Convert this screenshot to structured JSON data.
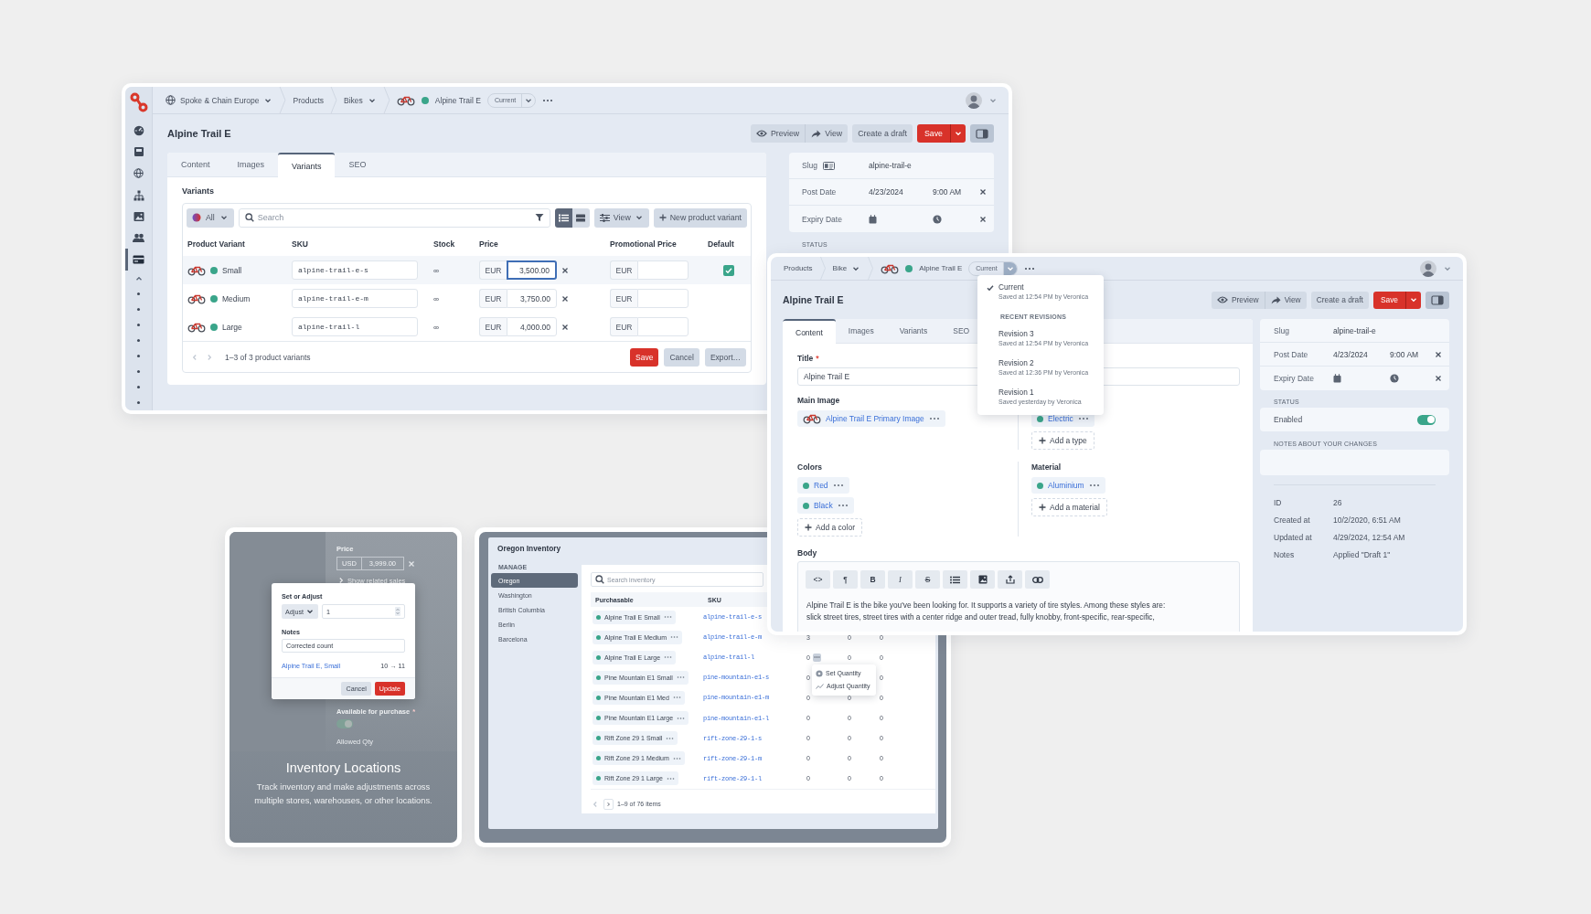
{
  "editor_window": {
    "nav_items": [
      {
        "selected": false
      },
      {
        "selected": false
      },
      {
        "selected": false
      },
      {
        "selected": false
      },
      {
        "selected": false
      },
      {
        "selected": false
      },
      {
        "selected": true
      }
    ],
    "breadcrumbs": [
      {
        "label": "Spoke & Chain Europe",
        "kind": "site",
        "dropdown": true
      },
      {
        "label": "Products",
        "dropdown": false
      },
      {
        "label": "Bikes",
        "dropdown": true
      }
    ],
    "record": {
      "label": "Alpine Trail E",
      "version": "Current",
      "menu_open": false
    },
    "title": "Alpine Trail E",
    "actions": [
      {
        "label": "Preview",
        "kind": "preview"
      },
      {
        "label": "View",
        "kind": "view"
      }
    ],
    "draft_button": "Create a draft",
    "save_button": "Save",
    "tabs": [
      {
        "label": "Content",
        "selected": false
      },
      {
        "label": "Images",
        "selected": false
      },
      {
        "label": "Variants",
        "selected": true
      },
      {
        "label": "SEO",
        "selected": false
      }
    ],
    "section_title": "Variants",
    "filter": "All",
    "search": {
      "placeholder": "Search"
    },
    "layouts": [
      {
        "kind": "list",
        "selected": true
      },
      {
        "kind": "rows",
        "selected": false
      }
    ],
    "view_menu": "View",
    "new_button": "New product variant",
    "columns": [
      "Product Variant",
      "SKU",
      "Stock",
      "Price",
      "Promotional Price",
      "Default"
    ],
    "rows": [
      {
        "name": "Small",
        "sku": "alpine-trail-e-s",
        "stock": "∞",
        "currency": "EUR",
        "price": "3,500.00",
        "promo_currency": "EUR",
        "focused": true,
        "default": true
      },
      {
        "name": "Medium",
        "sku": "alpine-trail-e-m",
        "stock": "∞",
        "currency": "EUR",
        "price": "3,750.00",
        "promo_currency": "EUR",
        "focused": false,
        "default": false
      },
      {
        "name": "Large",
        "sku": "alpine-trail-l",
        "stock": "∞",
        "currency": "EUR",
        "price": "4,000.00",
        "promo_currency": "EUR",
        "focused": false,
        "default": false
      }
    ],
    "pagination": "1–3 of 3 product variants",
    "table_buttons": [
      {
        "label": "Save",
        "kind": "primary"
      },
      {
        "label": "Cancel",
        "kind": "secondary"
      },
      {
        "label": "Export…",
        "kind": "secondary"
      }
    ],
    "meta": [
      {
        "kind": "slug",
        "label": "Slug",
        "badge": true,
        "value": "alpine-trail-e"
      },
      {
        "kind": "date",
        "label": "Post Date",
        "date": "4/23/2024",
        "time": "9:00 AM"
      },
      {
        "kind": "date",
        "label": "Expiry Date"
      }
    ],
    "status_label": "STATUS"
  },
  "content_window": {
    "breadcrumbs": [
      {
        "label": "Products",
        "dropdown": false
      },
      {
        "label": "Bike",
        "dropdown": true
      }
    ],
    "record": {
      "label": "Alpine Trail E",
      "version": "Current",
      "menu_open": true
    },
    "version_menu": {
      "current": {
        "label": "Current",
        "note": "Saved at 12:54 PM by Veronica",
        "selected": true
      },
      "heading": "RECENT REVISIONS",
      "revisions": [
        {
          "label": "Revision 3",
          "note": "Saved at 12:54 PM by Veronica",
          "selected": false
        },
        {
          "label": "Revision 2",
          "note": "Saved at 12:36 PM by Veronica",
          "selected": false
        },
        {
          "label": "Revision 1",
          "note": "Saved yesterday by Veronica",
          "selected": false
        }
      ]
    },
    "title": "Alpine Trail E",
    "actions": [
      {
        "label": "Preview",
        "kind": "preview"
      },
      {
        "label": "View",
        "kind": "view"
      }
    ],
    "draft_button": "Create a draft",
    "save_button": "Save",
    "tabs": [
      {
        "label": "Content",
        "selected": true
      },
      {
        "label": "Images",
        "selected": false
      },
      {
        "label": "Variants",
        "selected": false
      },
      {
        "label": "SEO",
        "selected": false
      }
    ],
    "title_field": {
      "label": "Title",
      "required_mark": "*",
      "value": "Alpine Trail E"
    },
    "main_image": {
      "label": "Main Image",
      "name": "Alpine Trail E Primary Image"
    },
    "types": [
      "Electric"
    ],
    "add_type": "Add a type",
    "colors_label": "Colors",
    "colors": [
      "Red",
      "Black"
    ],
    "add_color": "Add a color",
    "material_label": "Material",
    "materials": [
      "Aluminium"
    ],
    "add_material": "Add a material",
    "body_label": "Body",
    "editor_tools": [
      {
        "kind": "code",
        "label": "<>"
      },
      {
        "kind": "paragraph",
        "label": "¶"
      },
      {
        "kind": "bold",
        "label": "B"
      },
      {
        "kind": "italic",
        "label": "I"
      },
      {
        "kind": "strike",
        "label": "S"
      },
      {
        "kind": "list"
      },
      {
        "kind": "image"
      },
      {
        "kind": "embed"
      },
      {
        "kind": "link"
      }
    ],
    "body_lines": [
      "Alpine Trail E is the bike you've been looking for. It supports a variety of tire styles. Among these styles are:",
      "slick street tires, street tires with a center ridge and outer tread, fully knobby, front-specific, rear-specific,"
    ],
    "meta": [
      {
        "kind": "slug",
        "label": "Slug",
        "badge": false,
        "value": "alpine-trail-e"
      },
      {
        "kind": "date",
        "label": "Post Date",
        "date": "4/23/2024",
        "time": "9:00 AM"
      },
      {
        "kind": "date",
        "label": "Expiry Date"
      }
    ],
    "status_label": "STATUS",
    "enabled": {
      "label": "Enabled",
      "on": true
    },
    "notes_label": "NOTES ABOUT YOUR CHANGES",
    "info": [
      {
        "label": "ID",
        "value": "26"
      },
      {
        "label": "Created at",
        "value": "10/2/2020, 6:51 AM"
      },
      {
        "label": "Updated at",
        "value": "4/29/2024, 12:54 AM"
      },
      {
        "label": "Notes",
        "value": "Applied \"Draft 1\""
      }
    ]
  },
  "locations_card": {
    "backdrop": {
      "price_label": "Price",
      "currency": "USD",
      "price": "3,999.00",
      "related_link": "Show related sales",
      "available_label": "Available for purchase",
      "required_mark": "*",
      "available_on": true,
      "allowed_label": "Allowed Qty"
    },
    "dialog": {
      "title": "Set or Adjust",
      "mode": "Adjust",
      "amount": "1",
      "notes_label": "Notes",
      "notes": "Corrected count",
      "item": "Alpine Trail E, Small",
      "change": "10 → 11",
      "buttons": [
        {
          "label": "Cancel",
          "kind": "secondary"
        },
        {
          "label": "Update",
          "kind": "primary"
        }
      ]
    },
    "heading": "Inventory Locations",
    "description": "Track inventory and make adjustments across multiple stores, warehouses, or other locations."
  },
  "inventory_window": {
    "title": "Oregon Inventory",
    "nav_heading": "MANAGE",
    "locations": [
      {
        "label": "Oregon",
        "selected": true
      },
      {
        "label": "Washington",
        "selected": false
      },
      {
        "label": "British Columbia",
        "selected": false
      },
      {
        "label": "Berlin",
        "selected": false
      },
      {
        "label": "Barcelona",
        "selected": false
      }
    ],
    "search": {
      "placeholder": "Search inventory"
    },
    "columns": [
      "Purchasable",
      "SKU"
    ],
    "rows": [
      {
        "name": "Alpine Trail E Small",
        "sku": "alpine-trail-e-s"
      },
      {
        "name": "Alpine Trail E Medium",
        "sku": "alpine-trail-e-m",
        "column_3": "3",
        "column_4": "0",
        "column_5": "0"
      },
      {
        "name": "Alpine Trail E Large",
        "sku": "alpine-trail-l",
        "column_3": "0",
        "column_4": "0",
        "column_5": "0",
        "menu_open": true
      },
      {
        "name": "Pine Mountain E1 Small",
        "sku": "pine-mountain-e1-s",
        "column_3": "0",
        "column_5": "0"
      },
      {
        "name": "Pine Mountain E1 Med",
        "sku": "pine-mountain-e1-m",
        "column_3": "0",
        "column_4": "0",
        "column_5": "0"
      },
      {
        "name": "Pine Mountain E1 Large",
        "sku": "pine-mountain-e1-l",
        "column_3": "0",
        "column_4": "0",
        "column_5": "0"
      },
      {
        "name": "Rift Zone 29 1 Small",
        "sku": "rift-zone-29-1-s",
        "column_3": "0",
        "column_4": "0",
        "column_5": "0"
      },
      {
        "name": "Rift Zone 29 1 Medium",
        "sku": "rift-zone-29-1-m",
        "column_3": "0",
        "column_4": "0",
        "column_5": "0"
      },
      {
        "name": "Rift Zone 29 1 Large",
        "sku": "rift-zone-29-1-l",
        "column_3": "0",
        "column_4": "0",
        "column_5": "0"
      }
    ],
    "row_menu": [
      {
        "label": "Set Quantity",
        "kind": "set"
      },
      {
        "label": "Adjust Quantity",
        "kind": "adjust"
      }
    ],
    "pagination": "1–9 of 76 items"
  }
}
